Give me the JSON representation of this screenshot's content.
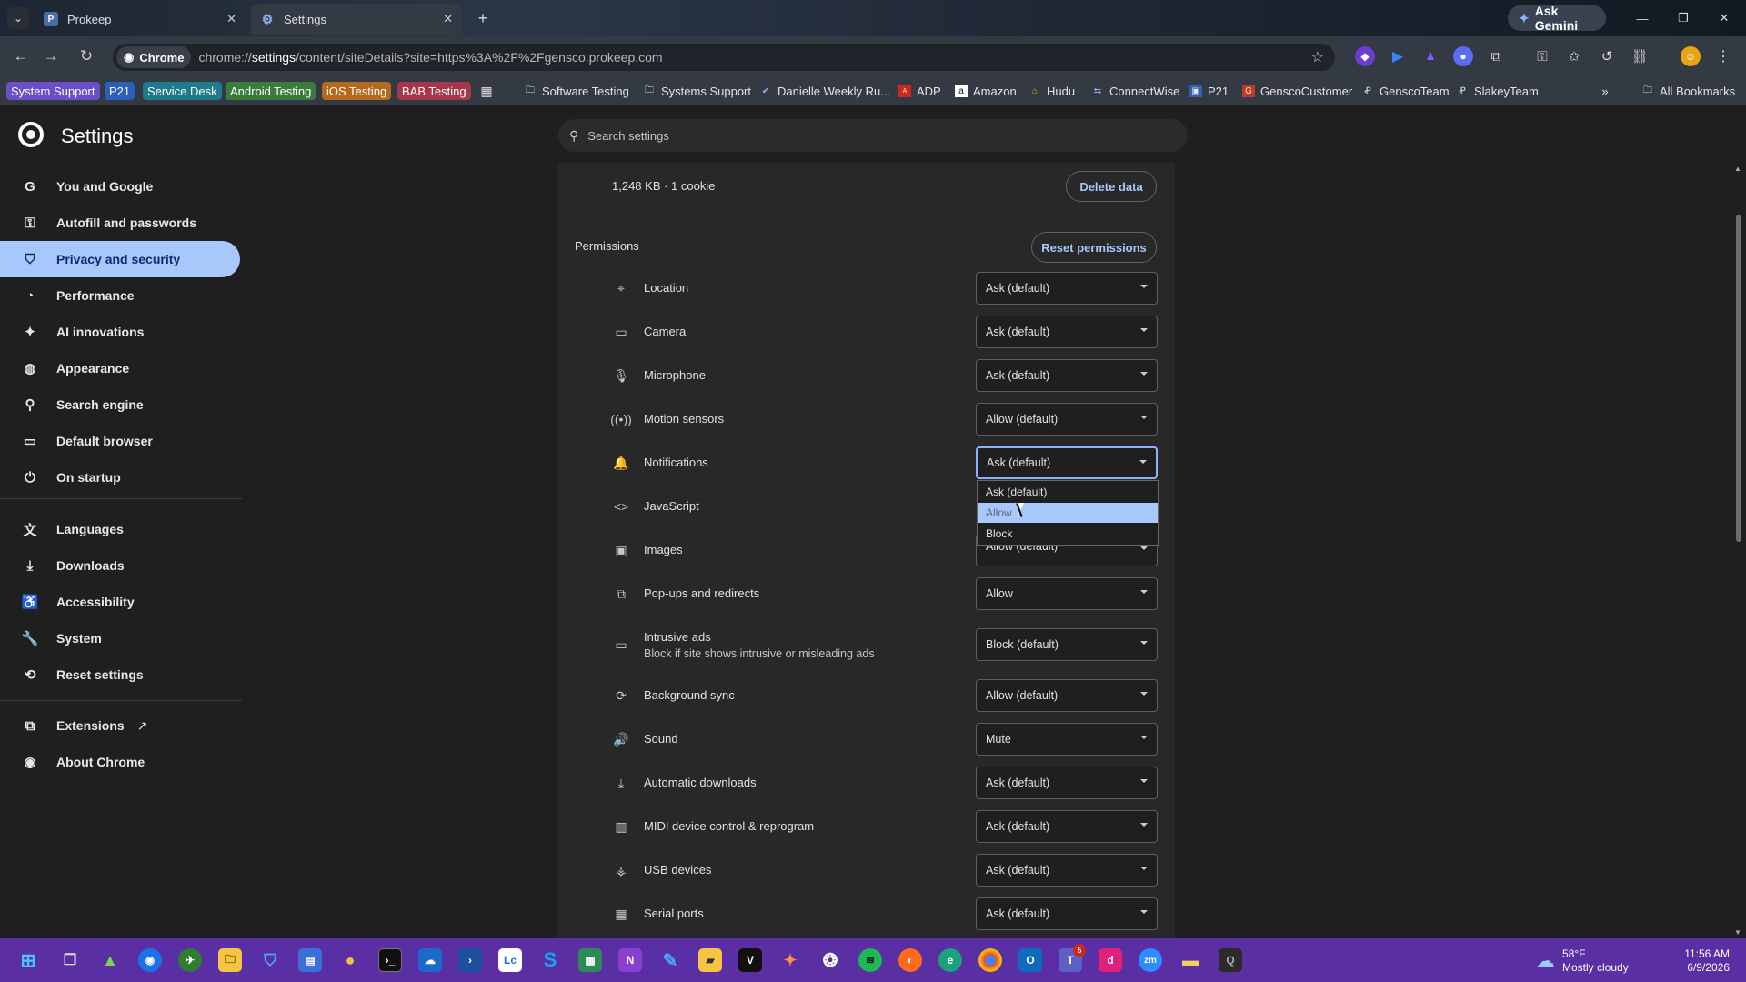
{
  "tabs": [
    {
      "label": "Prokeep",
      "icon": "prokeep-icon"
    },
    {
      "label": "Settings",
      "icon": "gear-icon"
    }
  ],
  "gemini_label": "Ask Gemini",
  "omnibox": {
    "chip": "Chrome",
    "url_pre": "chrome://",
    "url_host": "settings",
    "url_rest": "/content/siteDetails?site=https%3A%2F%2Fgensco.prokeep.com"
  },
  "bookmark_tags": [
    {
      "label": "System Support",
      "color": "#6b4fc8"
    },
    {
      "label": "P21",
      "color": "#2c5fb8"
    },
    {
      "label": "Service Desk",
      "color": "#1f7a8c"
    },
    {
      "label": "Android Testing",
      "color": "#3a7d3a"
    },
    {
      "label": "iOS Testing",
      "color": "#b46a1e"
    },
    {
      "label": "BAB Testing",
      "color": "#a6364a"
    }
  ],
  "bookmarks": [
    {
      "label": "Software Testing",
      "icon": "folder-icon"
    },
    {
      "label": "Systems Support",
      "icon": "folder-icon"
    },
    {
      "label": "Danielle Weekly Ru...",
      "icon": "check-icon"
    },
    {
      "label": "ADP",
      "icon": "adp-icon"
    },
    {
      "label": "Amazon",
      "icon": "amazon-icon"
    },
    {
      "label": "Hudu",
      "icon": "hudu-icon"
    },
    {
      "label": "ConnectWise",
      "icon": "connectwise-icon"
    },
    {
      "label": "P21",
      "icon": "p21-icon"
    },
    {
      "label": "GenscoCustomer",
      "icon": "gensco-icon"
    },
    {
      "label": "GenscoTeam",
      "icon": "prokeep-icon"
    },
    {
      "label": "SlakeyTeam",
      "icon": "prokeep-icon"
    }
  ],
  "all_bookmarks": "All Bookmarks",
  "settings": {
    "title": "Settings",
    "search_placeholder": "Search settings"
  },
  "nav": [
    {
      "label": "You and Google",
      "icon": "google-icon"
    },
    {
      "label": "Autofill and passwords",
      "icon": "key-icon"
    },
    {
      "label": "Privacy and security",
      "icon": "shield-icon"
    },
    {
      "label": "Performance",
      "icon": "speedometer-icon"
    },
    {
      "label": "AI innovations",
      "icon": "sparkle-icon"
    },
    {
      "label": "Appearance",
      "icon": "palette-icon"
    },
    {
      "label": "Search engine",
      "icon": "search-icon"
    },
    {
      "label": "Default browser",
      "icon": "browser-icon"
    },
    {
      "label": "On startup",
      "icon": "power-icon"
    },
    {
      "label": "Languages",
      "icon": "translate-icon"
    },
    {
      "label": "Downloads",
      "icon": "download-icon"
    },
    {
      "label": "Accessibility",
      "icon": "accessibility-icon"
    },
    {
      "label": "System",
      "icon": "wrench-icon"
    },
    {
      "label": "Reset settings",
      "icon": "reset-icon"
    },
    {
      "label": "Extensions",
      "icon": "puzzle-icon"
    },
    {
      "label": "About Chrome",
      "icon": "chrome-icon"
    }
  ],
  "site": {
    "usage": "1,248 KB · 1 cookie",
    "delete_label": "Delete data",
    "permissions_heading": "Permissions",
    "reset_label": "Reset permissions"
  },
  "permissions": [
    {
      "label": "Location",
      "value": "Ask (default)",
      "icon": "location-icon"
    },
    {
      "label": "Camera",
      "value": "Ask (default)",
      "icon": "camera-icon"
    },
    {
      "label": "Microphone",
      "value": "Ask (default)",
      "icon": "microphone-icon"
    },
    {
      "label": "Motion sensors",
      "value": "Allow (default)",
      "icon": "sensors-icon"
    },
    {
      "label": "Notifications",
      "value": "Ask (default)",
      "icon": "bell-icon"
    },
    {
      "label": "JavaScript",
      "value": "",
      "icon": "code-icon"
    },
    {
      "label": "Images",
      "value": "Allow (default)",
      "icon": "image-icon"
    },
    {
      "label": "Pop-ups and redirects",
      "value": "Allow",
      "icon": "external-link-icon"
    },
    {
      "label": "Intrusive ads",
      "sub": "Block if site shows intrusive or misleading ads",
      "value": "Block (default)",
      "icon": "ads-icon"
    },
    {
      "label": "Background sync",
      "value": "Allow (default)",
      "icon": "sync-icon"
    },
    {
      "label": "Sound",
      "value": "Mute",
      "icon": "speaker-icon"
    },
    {
      "label": "Automatic downloads",
      "value": "Ask (default)",
      "icon": "download-icon"
    },
    {
      "label": "MIDI device control & reprogram",
      "value": "Ask (default)",
      "icon": "piano-icon"
    },
    {
      "label": "USB devices",
      "value": "Ask (default)",
      "icon": "usb-icon"
    },
    {
      "label": "Serial ports",
      "value": "Ask (default)",
      "icon": "serial-icon"
    }
  ],
  "dropdown_options": [
    "Ask (default)",
    "Allow",
    "Block"
  ],
  "weather": {
    "temp": "58°F",
    "desc": "Mostly cloudy"
  },
  "clock": {
    "time": "11:56 AM",
    "date": "6/9/2026"
  },
  "taskbar_badge": "5"
}
